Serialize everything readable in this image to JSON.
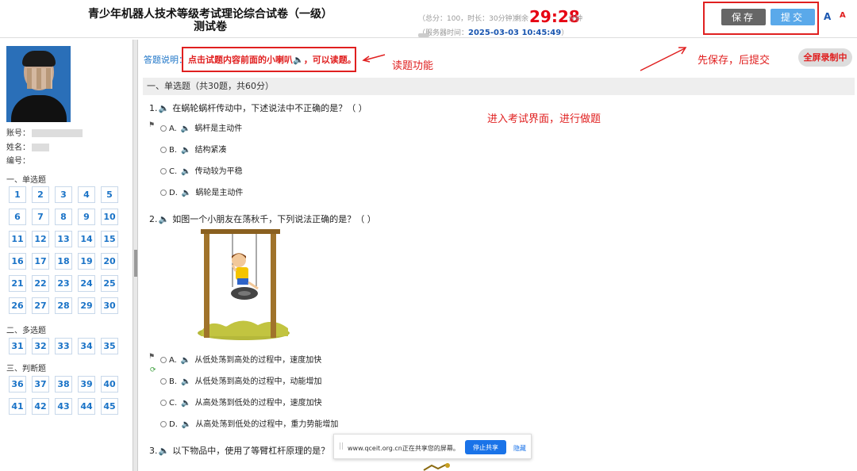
{
  "header": {
    "title_line1": "青少年机器人技术等级考试理论综合试卷（一级）",
    "title_line2": "测试卷",
    "exam_info": "（总分：100，时长：30分钟）",
    "remaining_label": "剩余",
    "timer": "29:28",
    "timer_unit": "分钟",
    "server_time_label": "（服务器时间：",
    "server_time": "2025-03-03 10:45:49",
    "server_time_close": "）",
    "save_label": "保存",
    "submit_label": "提交",
    "font_large": "A",
    "font_small": "A"
  },
  "sidebar": {
    "account_label": "账号：",
    "name_label": "姓名：",
    "id_label": "编号：",
    "sections": [
      {
        "label": "一、单选题",
        "numbers": [
          "1",
          "2",
          "3",
          "4",
          "5",
          "6",
          "7",
          "8",
          "9",
          "10",
          "11",
          "12",
          "13",
          "14",
          "15",
          "16",
          "17",
          "18",
          "19",
          "20",
          "21",
          "22",
          "23",
          "24",
          "25",
          "26",
          "27",
          "28",
          "29",
          "30"
        ]
      },
      {
        "label": "二、多选题",
        "numbers": [
          "31",
          "32",
          "33",
          "34",
          "35"
        ]
      },
      {
        "label": "三、判断题",
        "numbers": [
          "36",
          "37",
          "38",
          "39",
          "40",
          "41",
          "42",
          "43",
          "44",
          "45"
        ]
      }
    ]
  },
  "main": {
    "instr_label": "答题说明：",
    "instr_text_a": "点击试题内容前面的小喇叭",
    "instr_text_b": "，可以读题。",
    "fullscreen_label": "全屏录制中",
    "section_title": "一、单选题（共30题，共60分）",
    "questions": [
      {
        "num": "1.",
        "text": "在蜗轮蜗杆传动中，下述说法中不正确的是？（ ）",
        "options": [
          {
            "letter": "A.",
            "text": "蜗杆是主动件"
          },
          {
            "letter": "B.",
            "text": "结构紧凑"
          },
          {
            "letter": "C.",
            "text": "传动较为平稳"
          },
          {
            "letter": "D.",
            "text": "蜗轮是主动件"
          }
        ]
      },
      {
        "num": "2.",
        "text": "如图一个小朋友在荡秋千，下列说法正确的是？（ ）",
        "options": [
          {
            "letter": "A.",
            "text": "从低处荡到高处的过程中，速度加快"
          },
          {
            "letter": "B.",
            "text": "从低处荡到高处的过程中，动能增加"
          },
          {
            "letter": "C.",
            "text": "从高处荡到低处的过程中，速度加快"
          },
          {
            "letter": "D.",
            "text": "从高处荡到低处的过程中，重力势能增加"
          }
        ]
      },
      {
        "num": "3.",
        "text": "以下物品中，使用了等臂杠杆原理的是？（"
      }
    ]
  },
  "annotations": {
    "read_feature": "读题功能",
    "save_then_submit": "先保存，后提交",
    "enter_exam": "进入考试界面，进行做题"
  },
  "toast": {
    "text": "www.qceit.org.cn正在共享您的屏幕。",
    "stop_label": "停止共享",
    "hide_label": "隐藏",
    "grip": "||"
  },
  "icons": {
    "speaker": "speaker-icon",
    "flag": "flag-icon",
    "refresh": "refresh-icon"
  },
  "colors": {
    "accent": "#1a73c7",
    "alert": "#e02020",
    "submit": "#5aa9ea",
    "save": "#666666"
  }
}
